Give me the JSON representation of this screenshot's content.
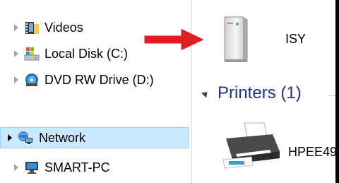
{
  "nav": {
    "items": [
      {
        "label": "Videos",
        "icon": "videos-folder-icon"
      },
      {
        "label": "Local Disk (C:)",
        "icon": "local-disk-icon"
      },
      {
        "label": "DVD RW Drive (D:)",
        "icon": "dvd-drive-icon"
      },
      {
        "label": "Network",
        "icon": "network-icon",
        "selected": true
      },
      {
        "label": "SMART-PC",
        "icon": "computer-icon"
      }
    ]
  },
  "content": {
    "devices": [
      {
        "label": "ISY",
        "icon": "network-device-icon"
      }
    ],
    "groups": [
      {
        "label": "Printers (1)"
      }
    ],
    "printers": [
      {
        "label": "HPEE49",
        "icon": "printer-icon"
      }
    ]
  },
  "colors": {
    "selection_bg": "#cce8ff",
    "selection_border": "#99d1ff",
    "group_header": "#1e3287",
    "annotation_arrow": "#e02020"
  }
}
